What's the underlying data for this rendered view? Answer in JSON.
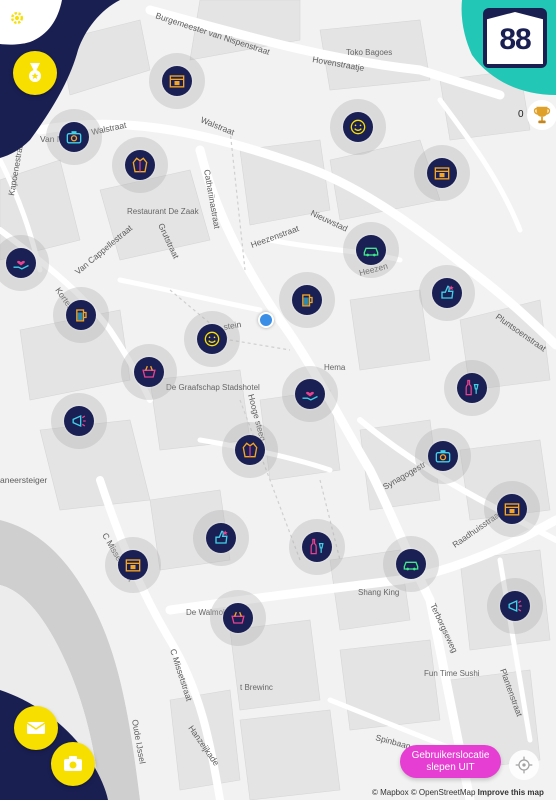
{
  "map": {
    "streets": [
      "Burgemeester van Nispenstraat",
      "Hovenstraatje",
      "Walstraat",
      "Walstraat",
      "Kapoenestraat",
      "Van M",
      "Van Cappellestraat",
      "Kortestraat",
      "Grutstraat",
      "Cathariinastraat",
      "Heezenstraat",
      "Nieuwstad",
      "Heezen",
      "Pluntsoenstraat",
      "Hooge steeg",
      "Synagogestr",
      "Raadhuisstraat",
      "C Missetstraat",
      "C Missetstraat",
      "Terborgseweg",
      "Spinbaan",
      "Hanzeijkade",
      "Plantenstraat",
      "aneersteiger",
      "Oude IJssel",
      "stein"
    ],
    "pois": [
      "Toko Bagoes",
      "Restaurant De Zaak",
      "De Graafschap Stadshotel",
      "Hema",
      "Shang King",
      "De Walmol",
      "Fun Time Sushi",
      "t Brewinc"
    ]
  },
  "markers": [
    {
      "icon": "shop-box-icon"
    },
    {
      "icon": "camera-icon"
    },
    {
      "icon": "jacket-icon"
    },
    {
      "icon": "smiley-icon"
    },
    {
      "icon": "shop-box-icon"
    },
    {
      "icon": "hand-heart-icon"
    },
    {
      "icon": "car-icon"
    },
    {
      "icon": "beer-glass-icon"
    },
    {
      "icon": "thumbs-up-icon"
    },
    {
      "icon": "beer-glass-icon"
    },
    {
      "icon": "smiley-icon"
    },
    {
      "icon": "restaurant-icon"
    },
    {
      "icon": "wine-bottle-icon"
    },
    {
      "icon": "hand-heart-icon"
    },
    {
      "icon": "megaphone-icon"
    },
    {
      "icon": "jacket-icon"
    },
    {
      "icon": "camera-icon"
    },
    {
      "icon": "shop-box-icon"
    },
    {
      "icon": "thumbs-up-icon"
    },
    {
      "icon": "wine-bottle-icon"
    },
    {
      "icon": "car-icon"
    },
    {
      "icon": "shop-box-icon"
    },
    {
      "icon": "restaurant-icon"
    },
    {
      "icon": "megaphone-icon"
    }
  ],
  "colors": {
    "accent_yellow": "#f7df00",
    "navy": "#1a1f52",
    "teal": "#22c7b6",
    "drag_button": "#e63ed3",
    "user_location": "#3b8ee6"
  },
  "logo_text": "88",
  "score": "0",
  "drag_button": {
    "line1": "Gebruikerslocatie",
    "line2": "slepen UIT"
  },
  "attribution": {
    "mapbox": "© Mapbox",
    "osm": "© OpenStreetMap",
    "improve": "Improve this map"
  },
  "icons": {
    "settings": "gear-icon",
    "medal": "medal-icon",
    "trophy": "trophy-icon",
    "mail": "mail-icon",
    "camera": "camera-icon",
    "locate": "locate-icon"
  }
}
